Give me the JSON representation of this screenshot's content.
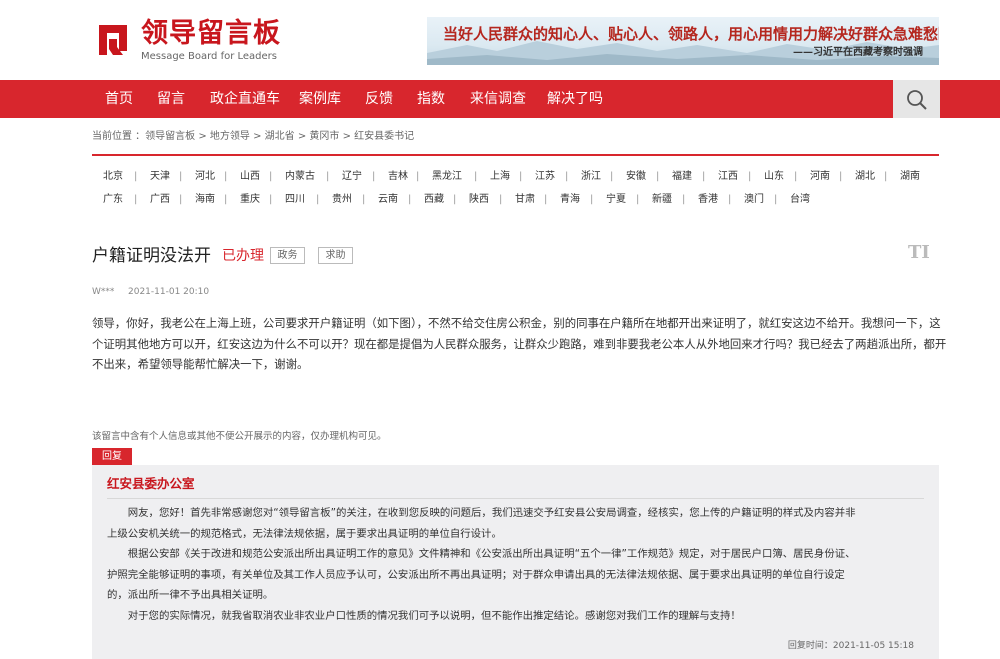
{
  "logo": {
    "cn": "领导留言板",
    "en": "Message Board for Leaders"
  },
  "banner": {
    "quote": "当好人民群众的知心人、贴心人、领路人，用心用情用力解决好群众急难愁盼问题。",
    "source": "——习近平在西藏考察时强调"
  },
  "nav": {
    "items": [
      "首页",
      "留言",
      "政企直通车",
      "案例库",
      "反馈",
      "指数",
      "来信调查",
      "解决了吗"
    ],
    "search_icon": "search-icon"
  },
  "breadcrumb": "当前位置 ：领导留言板 > 地方领导 > 湖北省 > 黄冈市 > 红安县委书记",
  "regions": {
    "row1": [
      "北京",
      "天津",
      "河北",
      "山西",
      "内蒙古",
      "辽宁",
      "吉林",
      "黑龙江",
      "上海",
      "江苏",
      "浙江",
      "安徽",
      "福建",
      "江西",
      "山东",
      "河南",
      "湖北",
      "湖南"
    ],
    "row2": [
      "广东",
      "广西",
      "海南",
      "重庆",
      "四川",
      "贵州",
      "云南",
      "西藏",
      "陕西",
      "甘肃",
      "青海",
      "宁夏",
      "新疆",
      "香港",
      "澳门",
      "台湾"
    ]
  },
  "post": {
    "title": "户籍证明没法开",
    "status": "已办理",
    "tags": [
      "政务",
      "求助"
    ],
    "font_toggle": "TI",
    "author": "W***",
    "date": "2021-11-01 20:10",
    "body_lines": [
      "领导，你好，我老公在上海上班，公司要求开户籍证明（如下图），不然不给交住房公积金，别的同事在户籍所在地都开出来证明了，就红安这边不给开。我想问一下，这",
      "个证明其他地方可以开，红安这边为什么不可以开？现在都是提倡为人民群众服务，让群众少跑路，难到非要我老公本人从外地回来才行吗？我已经去了两趟派出所，都开",
      "不出来，希望领导能帮忙解决一下，谢谢。"
    ],
    "privacy_note": "该留言中含有个人信息或其他不便公开展示的内容，仅办理机构可见。"
  },
  "reply": {
    "tab_label": "回复",
    "department": "红安县委办公室",
    "lines": [
      "　　网友，您好！首先非常感谢您对“领导留言板”的关注，在收到您反映的问题后，我们迅速交予红安县公安局调查，经核实，您上传的户籍证明的样式及内容并非",
      "上级公安机关统一的规范格式，无法律法规依据，属于要求出具证明的单位自行设计。",
      "　　根据公安部《关于改进和规范公安派出所出具证明工作的意见》文件精神和《公安派出所出具证明“五个一律”工作规范》规定，对于居民户口簿、居民身份证、",
      "护照完全能够证明的事项，有关单位及其工作人员应予认可，公安派出所不再出具证明；对于群众申请出具的无法律法规依据、属于要求出具证明的单位自行设定",
      "的，派出所一律不予出具相关证明。",
      "　　对于您的实际情况，就我省取消农业非农业户口性质的情况我们可予以说明，但不能作出推定结论。感谢您对我们工作的理解与支持！"
    ],
    "time": "回复时间：2021-11-05 15:18"
  },
  "colors": {
    "brand_red": "#d8262d",
    "reply_bg": "#efeff1"
  }
}
